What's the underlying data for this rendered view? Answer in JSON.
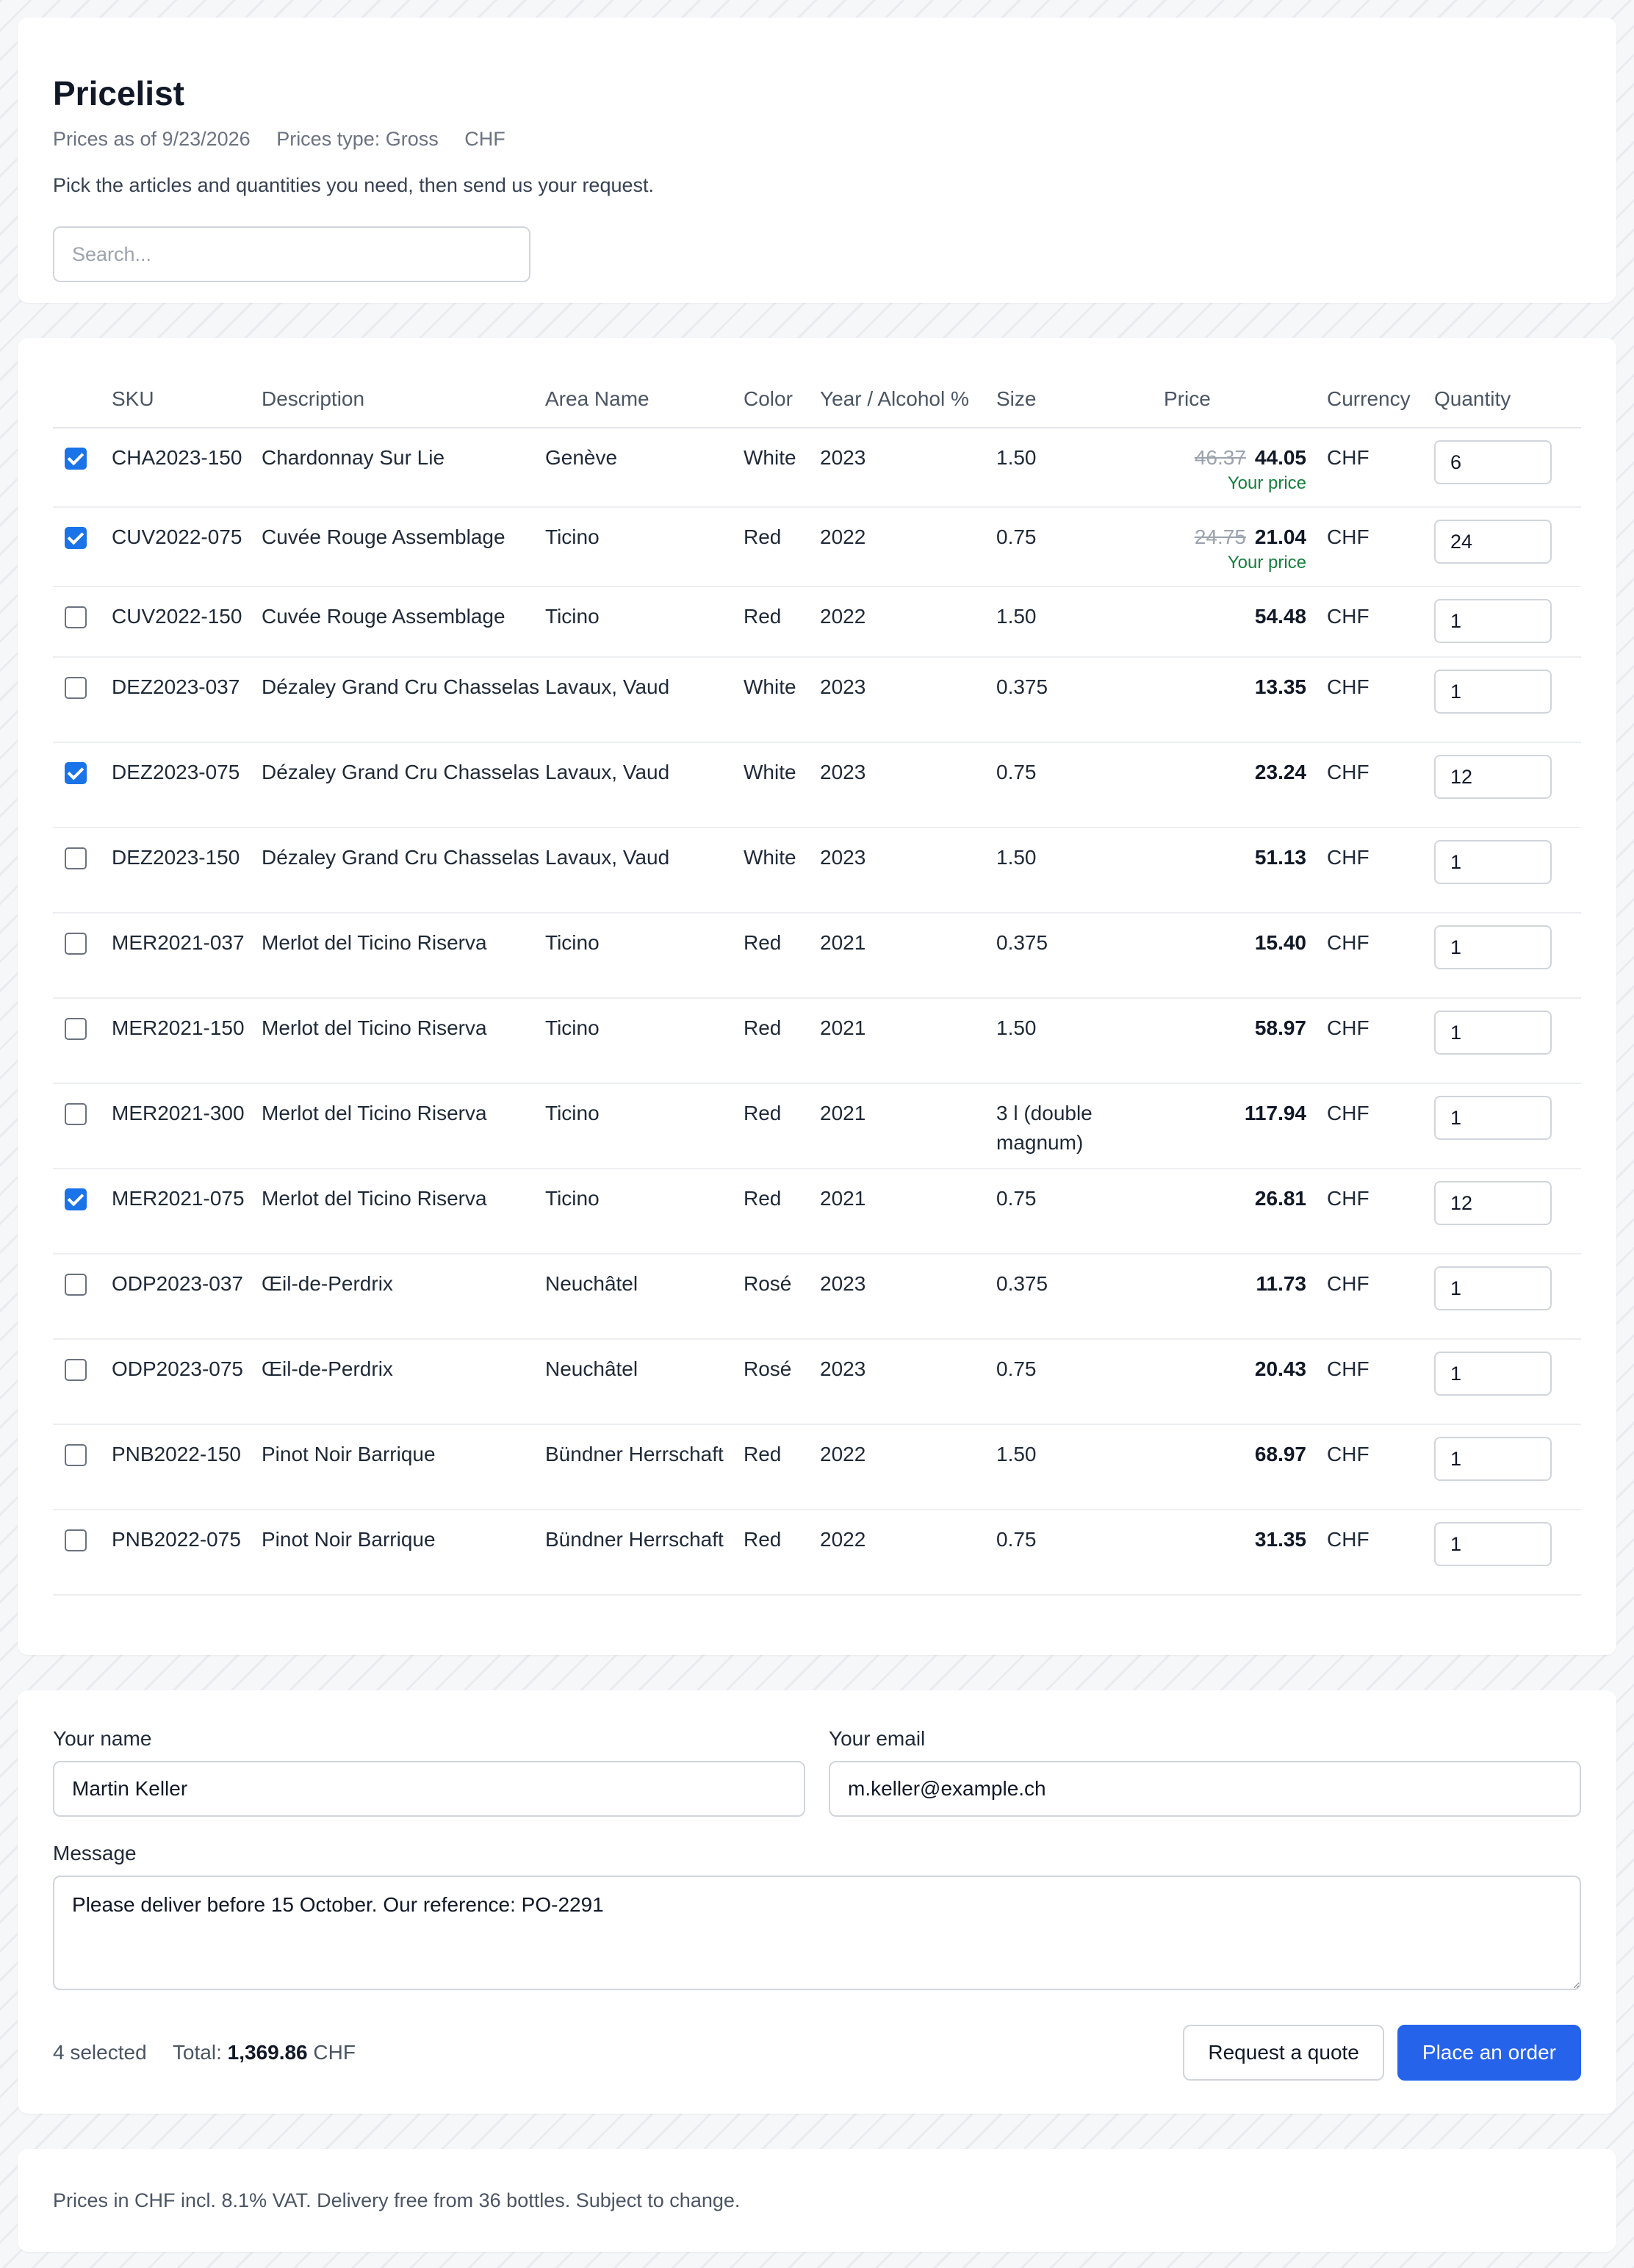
{
  "header": {
    "title": "Pricelist",
    "prices_as_of": "Prices as of 9/23/2026",
    "prices_type": "Prices type: Gross",
    "currency": "CHF",
    "intro": "Pick the articles and quantities you need, then send us your request.",
    "search_placeholder": "Search..."
  },
  "table": {
    "columns": {
      "sku": "SKU",
      "description": "Description",
      "area": "Area Name",
      "color": "Color",
      "year": "Year / Alcohol %",
      "size": "Size",
      "price": "Price",
      "currency": "Currency",
      "quantity": "Quantity"
    },
    "your_price_label": "Your price",
    "rows": [
      {
        "checked": true,
        "sku": "CHA2023-150",
        "description": "Chardonnay Sur Lie",
        "area": "Genève",
        "color": "White",
        "year": "2023",
        "size": "1.50",
        "old_price": "46.37",
        "price": "44.05",
        "your_price": true,
        "currency": "CHF",
        "quantity": "6"
      },
      {
        "checked": true,
        "sku": "CUV2022-075",
        "description": "Cuvée Rouge Assemblage",
        "area": "Ticino",
        "color": "Red",
        "year": "2022",
        "size": "0.75",
        "old_price": "24.75",
        "price": "21.04",
        "your_price": true,
        "currency": "CHF",
        "quantity": "24"
      },
      {
        "checked": false,
        "sku": "CUV2022-150",
        "description": "Cuvée Rouge Assemblage",
        "area": "Ticino",
        "color": "Red",
        "year": "2022",
        "size": "1.50",
        "old_price": "",
        "price": "54.48",
        "your_price": false,
        "currency": "CHF",
        "quantity": "1"
      },
      {
        "checked": false,
        "sku": "DEZ2023-037",
        "description": "Dézaley Grand Cru Chasselas",
        "area": "Lavaux, Vaud",
        "color": "White",
        "year": "2023",
        "size": "0.375",
        "old_price": "",
        "price": "13.35",
        "your_price": false,
        "currency": "CHF",
        "quantity": "1"
      },
      {
        "checked": true,
        "sku": "DEZ2023-075",
        "description": "Dézaley Grand Cru Chasselas",
        "area": "Lavaux, Vaud",
        "color": "White",
        "year": "2023",
        "size": "0.75",
        "old_price": "",
        "price": "23.24",
        "your_price": false,
        "currency": "CHF",
        "quantity": "12"
      },
      {
        "checked": false,
        "sku": "DEZ2023-150",
        "description": "Dézaley Grand Cru Chasselas",
        "area": "Lavaux, Vaud",
        "color": "White",
        "year": "2023",
        "size": "1.50",
        "old_price": "",
        "price": "51.13",
        "your_price": false,
        "currency": "CHF",
        "quantity": "1"
      },
      {
        "checked": false,
        "sku": "MER2021-037",
        "description": "Merlot del Ticino Riserva",
        "area": "Ticino",
        "color": "Red",
        "year": "2021",
        "size": "0.375",
        "old_price": "",
        "price": "15.40",
        "your_price": false,
        "currency": "CHF",
        "quantity": "1"
      },
      {
        "checked": false,
        "sku": "MER2021-150",
        "description": "Merlot del Ticino Riserva",
        "area": "Ticino",
        "color": "Red",
        "year": "2021",
        "size": "1.50",
        "old_price": "",
        "price": "58.97",
        "your_price": false,
        "currency": "CHF",
        "quantity": "1"
      },
      {
        "checked": false,
        "sku": "MER2021-300",
        "description": "Merlot del Ticino Riserva",
        "area": "Ticino",
        "color": "Red",
        "year": "2021",
        "size": "3 l (double magnum)",
        "old_price": "",
        "price": "117.94",
        "your_price": false,
        "currency": "CHF",
        "quantity": "1"
      },
      {
        "checked": true,
        "sku": "MER2021-075",
        "description": "Merlot del Ticino Riserva",
        "area": "Ticino",
        "color": "Red",
        "year": "2021",
        "size": "0.75",
        "old_price": "",
        "price": "26.81",
        "your_price": false,
        "currency": "CHF",
        "quantity": "12"
      },
      {
        "checked": false,
        "sku": "ODP2023-037",
        "description": "Œil-de-Perdrix",
        "area": "Neuchâtel",
        "color": "Rosé",
        "year": "2023",
        "size": "0.375",
        "old_price": "",
        "price": "11.73",
        "your_price": false,
        "currency": "CHF",
        "quantity": "1"
      },
      {
        "checked": false,
        "sku": "ODP2023-075",
        "description": "Œil-de-Perdrix",
        "area": "Neuchâtel",
        "color": "Rosé",
        "year": "2023",
        "size": "0.75",
        "old_price": "",
        "price": "20.43",
        "your_price": false,
        "currency": "CHF",
        "quantity": "1"
      },
      {
        "checked": false,
        "sku": "PNB2022-150",
        "description": "Pinot Noir Barrique",
        "area": "Bündner Herrschaft",
        "color": "Red",
        "year": "2022",
        "size": "1.50",
        "old_price": "",
        "price": "68.97",
        "your_price": false,
        "currency": "CHF",
        "quantity": "1"
      },
      {
        "checked": false,
        "sku": "PNB2022-075",
        "description": "Pinot Noir Barrique",
        "area": "Bündner Herrschaft",
        "color": "Red",
        "year": "2022",
        "size": "0.75",
        "old_price": "",
        "price": "31.35",
        "your_price": false,
        "currency": "CHF",
        "quantity": "1"
      }
    ]
  },
  "form": {
    "name_label": "Your name",
    "name_value": "Martin Keller",
    "email_label": "Your email",
    "email_value": "m.keller@example.ch",
    "message_label": "Message",
    "message_value": "Please deliver before 15 October. Our reference: PO-2291",
    "selected_count": "4 selected",
    "total_label": "Total:",
    "total_value": "1,369.86",
    "total_currency": "CHF",
    "quote_button": "Request a quote",
    "order_button": "Place an order"
  },
  "note": {
    "text": "Prices in CHF incl. 8.1% VAT. Delivery free from 36 bottles. Subject to change."
  },
  "colors": {
    "accent": "#2563eb",
    "checkbox": "#1a73e8",
    "your_price": "#15803d"
  }
}
